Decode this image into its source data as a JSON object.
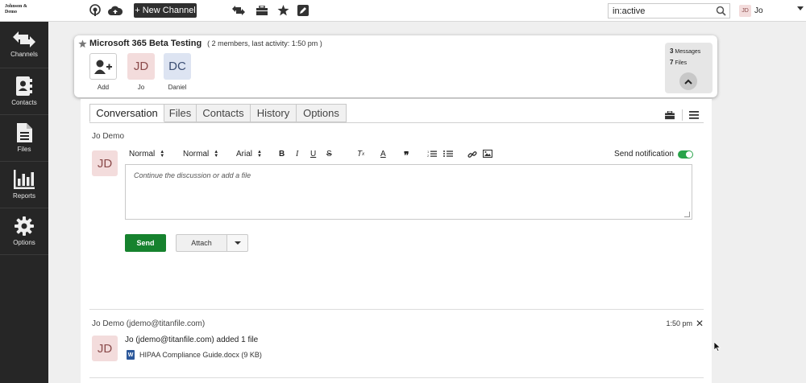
{
  "brand": {
    "logo_line1": "Johnson &",
    "logo_line2": "Demo"
  },
  "topbar": {
    "new_channel_label": "+ New Channel",
    "search_value": "in:active",
    "user_initials": "JD",
    "user_name": "Jo"
  },
  "sidebar": {
    "items": [
      {
        "label": "Channels",
        "icon": "arrows-exchange-icon"
      },
      {
        "label": "Contacts",
        "icon": "address-book-icon"
      },
      {
        "label": "Files",
        "icon": "file-icon"
      },
      {
        "label": "Reports",
        "icon": "bar-chart-icon"
      },
      {
        "label": "Options",
        "icon": "gear-icon"
      }
    ]
  },
  "channel": {
    "name": "Microsoft 365 Beta Testing",
    "meta": "( 2 members, last activity: 1:50 pm )",
    "members": [
      {
        "initials": "",
        "name": "Add"
      },
      {
        "initials": "JD",
        "name": "Jo"
      },
      {
        "initials": "DC",
        "name": "Daniel"
      }
    ],
    "stats": {
      "messages_count": "3",
      "messages_label": "Messages",
      "files_count": "7",
      "files_label": "Files"
    }
  },
  "tabs": [
    "Conversation",
    "Files",
    "Contacts",
    "History",
    "Options"
  ],
  "composer": {
    "author": "Jo Demo",
    "avatar_initials": "JD",
    "style_select": "Normal",
    "size_select": "Normal",
    "font_select": "Arial",
    "send_notification_label": "Send notification",
    "send_notification_on": true,
    "placeholder": "Continue the discussion or add a file",
    "send_label": "Send",
    "attach_label": "Attach"
  },
  "feed": {
    "author": "Jo Demo (jdemo@titanfile.com)",
    "time": "1:50 pm",
    "avatar_initials": "JD",
    "text": "Jo (jdemo@titanfile.com) added 1 file",
    "file": "HIPAA Compliance Guide.docx (9 KB)"
  },
  "colors": {
    "accent_green": "#16822e",
    "toggle_green": "#28a34a",
    "sidebar_bg": "#262626",
    "avatar_jd_bg": "#f3dcdc",
    "avatar_dc_bg": "#dde4f2"
  }
}
